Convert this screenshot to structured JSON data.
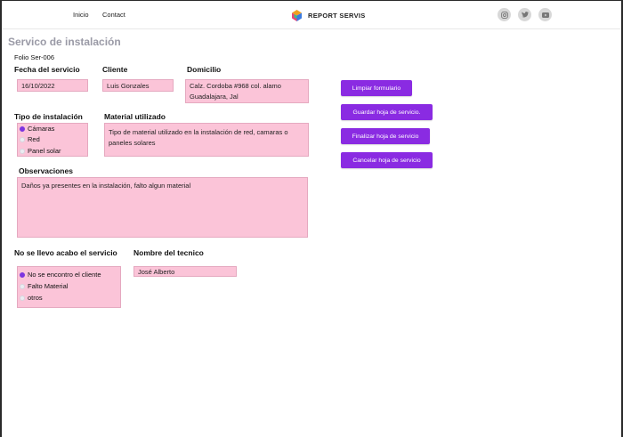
{
  "nav": {
    "home": "Inicio",
    "contact": "Contact"
  },
  "brand": {
    "name": "REPORT SERVIS"
  },
  "social": [
    {
      "icon": "instagram-icon"
    },
    {
      "icon": "twitter-icon"
    },
    {
      "icon": "youtube-icon"
    }
  ],
  "page": {
    "title": "Servico de instalación",
    "folio": "Folio Ser-006"
  },
  "form": {
    "fecha": {
      "label": "Fecha del servicio",
      "value": "16/10/2022"
    },
    "cliente": {
      "label": "Cliente",
      "value": "Luis Gonzales"
    },
    "domicilio": {
      "label": "Domicilio",
      "value": "Calz. Cordoba #968 col. alamo Guadalajara, Jal"
    },
    "tipo": {
      "label": "Tipo de instalación",
      "options": [
        "Cámaras",
        "Red",
        "Panel solar"
      ],
      "selected": "Cámaras"
    },
    "material": {
      "label": "Material utilizado",
      "value": "Tipo de material utilizado en la instalación  de red, camaras o paneles solares"
    },
    "observaciones": {
      "label": "Observaciones",
      "value": "Daños ya presentes en la instalación, falto algun material"
    },
    "no_servicio": {
      "label": "No se llevo acabo el servicio",
      "options": [
        "No se encontro el cliente",
        "Falto Material",
        "otros"
      ],
      "selected": "No se encontro el cliente"
    },
    "tecnico": {
      "label": "Nombre del tecnico",
      "value": "José Alberto"
    }
  },
  "actions": {
    "clear": "Limpiar formulario",
    "save": "Guardar hoja de servicio.",
    "finish": "Finalizar hoja de servicio",
    "cancel": "Cancelar hoja de servicio"
  },
  "colors": {
    "accent": "#8a2be2",
    "field_bg": "#fbc4d8",
    "title": "#9a9aa6"
  }
}
